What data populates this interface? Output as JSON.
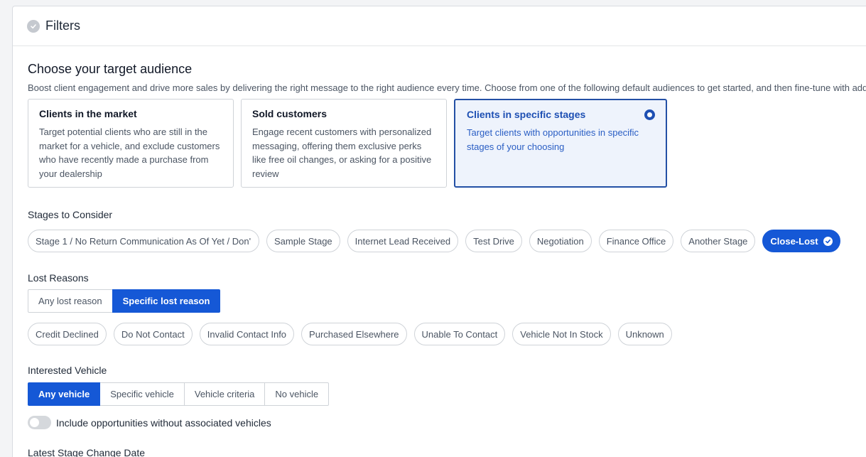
{
  "panel": {
    "title": "Filters"
  },
  "audience": {
    "heading": "Choose your target audience",
    "description": "Boost client engagement and drive more sales by delivering the right message to the right audience every time. Choose from one of the following default audiences to get started, and then fine-tune with add",
    "cards": [
      {
        "title": "Clients in the market",
        "body": "Target potential clients who are still in the market for a vehicle, and exclude customers who have recently made a purchase from your dealership"
      },
      {
        "title": "Sold customers",
        "body": "Engage recent customers with personalized messaging, offering them exclusive perks like free oil changes, or asking for a positive review"
      },
      {
        "title": "Clients in specific stages",
        "body": "Target clients with opportunities in specific stages of your choosing"
      }
    ]
  },
  "stages": {
    "label": "Stages to Consider",
    "items": [
      "Stage 1 / No Return Communication As Of Yet / Don'",
      "Sample Stage",
      "Internet Lead Received",
      "Test Drive",
      "Negotiation",
      "Finance Office",
      "Another Stage",
      "Close-Lost"
    ]
  },
  "lost_reasons": {
    "label": "Lost Reasons",
    "modes": [
      "Any lost reason",
      "Specific lost reason"
    ],
    "items": [
      "Credit Declined",
      "Do Not Contact",
      "Invalid Contact Info",
      "Purchased Elsewhere",
      "Unable To Contact",
      "Vehicle Not In Stock",
      "Unknown"
    ]
  },
  "vehicle": {
    "label": "Interested Vehicle",
    "modes": [
      "Any vehicle",
      "Specific vehicle",
      "Vehicle criteria",
      "No vehicle"
    ],
    "toggle_label": "Include opportunities without associated vehicles"
  },
  "latest_stage": {
    "label": "Latest Stage Change Date"
  },
  "colors": {
    "accent": "#1558d6",
    "selected_card_border": "#2350a5",
    "selected_card_bg": "#eef3fc"
  }
}
